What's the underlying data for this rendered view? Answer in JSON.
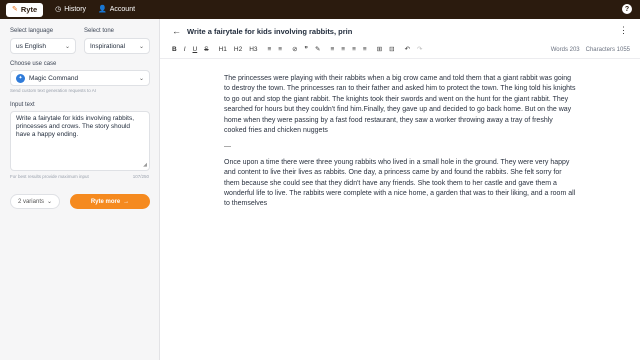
{
  "topbar": {
    "brand": "Ryte",
    "brand_icon": "pen-icon",
    "nav": [
      {
        "label": "History",
        "icon": "clock-icon"
      },
      {
        "label": "Account",
        "icon": "user-icon"
      }
    ],
    "help": "?"
  },
  "sidebar": {
    "language_label": "Select language",
    "language_value": "us English",
    "tone_label": "Select tone",
    "tone_value": "Inspirational",
    "use_case_label": "Choose use case",
    "use_case_value": "Magic Command",
    "use_case_helper": "Send custom text generation requests to AI",
    "input_label": "Input text",
    "input_value": "Write a fairytale for kids involving rabbits, princesses and crows. The story should have a happy ending.",
    "input_helper": "For best results provide maximum input",
    "input_count": "107/250",
    "variants_label": "2 variants",
    "ryte_button": "Ryte more",
    "ryte_arrow": "→"
  },
  "editor": {
    "back_icon": "←",
    "title": "Write a fairytale for kids involving rabbits, prin",
    "menu_icon": "⋮",
    "toolbar": [
      "B",
      "I",
      "U",
      "S",
      "H1",
      "H2",
      "H3",
      "≡",
      "≡",
      "⊘",
      "❞",
      "✎",
      "≡",
      "≡",
      "≡",
      "≡",
      "⊞",
      "⊟",
      "↶",
      "↷"
    ],
    "words": "Words 203",
    "characters": "Characters 1055",
    "paragraph1": "The princesses were playing with their rabbits when a big crow came and told them that a giant rabbit was going to destroy the town. The princesses ran to their father and asked him to protect the town. The king told his knights to go out and stop the giant rabbit. The knights took their swords and went on the hunt for the giant rabbit. They searched for hours but they couldn't find him.Finally, they gave up and decided to go back home. But on the way home when they were passing by a fast food restaurant, they saw a worker throwing away a tray of freshly cooked fries and chicken nuggets",
    "separator": "—",
    "paragraph2": "Once upon a time there were three young rabbits who lived in a small hole in the ground. They were very happy and content to live their lives as rabbits. One day, a princess came by and found the rabbits. She felt sorry for them because she could see that they didn't have any friends. She took them to her castle and gave them a wonderful life to live. The rabbits were complete with a nice home, a garden that was to their liking, and a room all to themselves"
  },
  "colors": {
    "topbar": "#2b1b0e",
    "accent": "#f58a1f",
    "use_case_icon": "#2f7bd9"
  }
}
